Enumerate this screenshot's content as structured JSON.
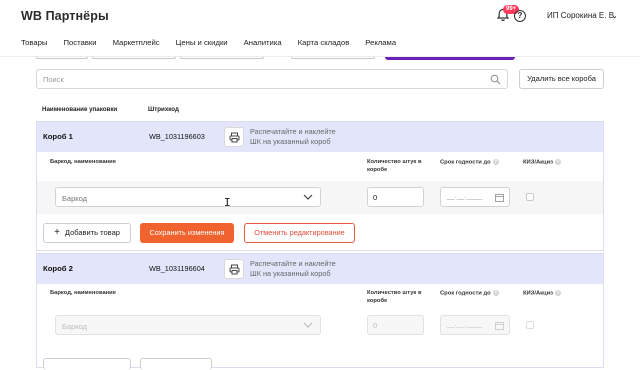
{
  "header": {
    "logo": "WB Партнёры",
    "notifications_badge": "99+",
    "help": "?",
    "user": "ИП Сорокина Е. В.",
    "user_chevron": "⌄"
  },
  "nav": [
    "Товары",
    "Поставки",
    "Маркетплейс",
    "Цены и скидки",
    "Аналитика",
    "Карта складов",
    "Реклама"
  ],
  "search": {
    "placeholder": "Поиск"
  },
  "delete_all_label": "Удалить все короба",
  "columns": {
    "packaging": "Наименование упаковки",
    "barcode": "Штрихкод"
  },
  "subcolumns": {
    "barcode_name": "Баркод, наименование",
    "qty": "Количество штук в коробе",
    "expiry": "Срок годности до",
    "kiz": "КИЗ/Акциз"
  },
  "print_hint_line1": "Распечатайте и наклейте",
  "print_hint_line2": "ШК на указанный короб",
  "boxes": [
    {
      "name": "Короб 1",
      "code": "WB_1031196603",
      "barcode_placeholder": "Баркод",
      "qty": "0",
      "date_placeholder": "__.__.____"
    },
    {
      "name": "Короб 2",
      "code": "WB_1031196604",
      "barcode_placeholder": "Баркод",
      "qty": "0",
      "date_placeholder": "__.__.____"
    }
  ],
  "actions": {
    "add_product": "Добавить товар",
    "save": "Сохранить изменения",
    "cancel": "Отменить редактирование"
  },
  "colors": {
    "accent": "#6a21b5",
    "orange": "#f0632e",
    "box_header": "#e3e6fb"
  }
}
